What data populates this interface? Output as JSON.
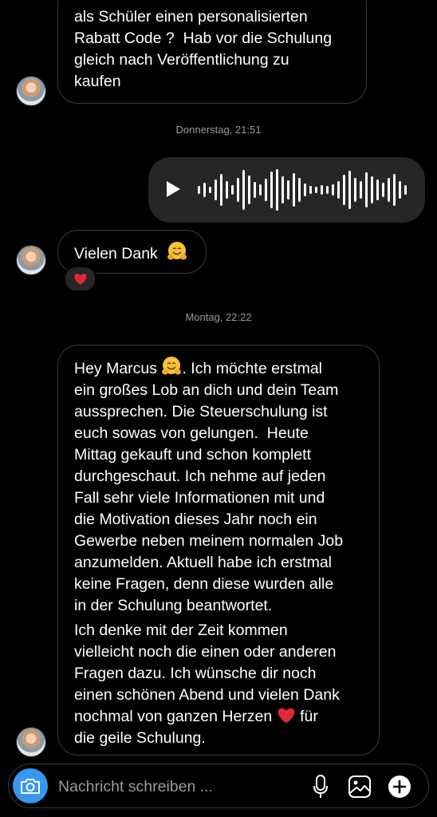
{
  "messages": {
    "msg1_text": "als Schüler einen personalisierten\nRabatt Code ?  Hab vor die Schulung\ngleich nach Veröffentlichung zu\nkaufen",
    "timestamp1": "Donnerstag, 21:51",
    "msg2_text": "Vielen Dank",
    "msg2_emoji": "hugging-face",
    "reaction_emoji": "red-heart",
    "timestamp2": "Montag, 22:22",
    "msg3_line1_prefix": "Hey Marcus",
    "msg3_para1_after_emoji": ". Ich möchte erstmal\nein großes Lob an dich und dein Team\naussprechen. Die Steuerschulung ist\neuch sowas von gelungen.  Heute\nMittag gekauft und schon komplett\ndurchgeschaut. Ich nehme auf jeden\nFall sehr viele Informationen mit und\ndie Motivation dieses Jahr noch ein\nGewerbe neben meinem normalen Job\nanzumelden. Aktuell habe ich erstmal\nkeine Fragen, denn diese wurden alle\nin der Schulung beantwortet.",
    "msg3_para2_before_heart": "Ich denke mit der Zeit kommen\nvielleicht noch die einen oder anderen\nFragen dazu. Ich wünsche dir noch\neinen schönen Abend und vielen Dank\nnochmal von ganzen Herzen",
    "msg3_para2_after_heart": " für\ndie geile Schulung."
  },
  "composer": {
    "placeholder": "Nachricht schreiben ...",
    "camera_icon": "camera-icon",
    "mic_icon": "microphone-icon",
    "gallery_icon": "gallery-icon",
    "add_icon": "plus-icon"
  },
  "colors": {
    "background": "#000000",
    "incoming_border": "#3a3a3a",
    "outgoing_bubble": "#262626",
    "camera_button": "#3897f0",
    "heart": "#e0283c"
  }
}
